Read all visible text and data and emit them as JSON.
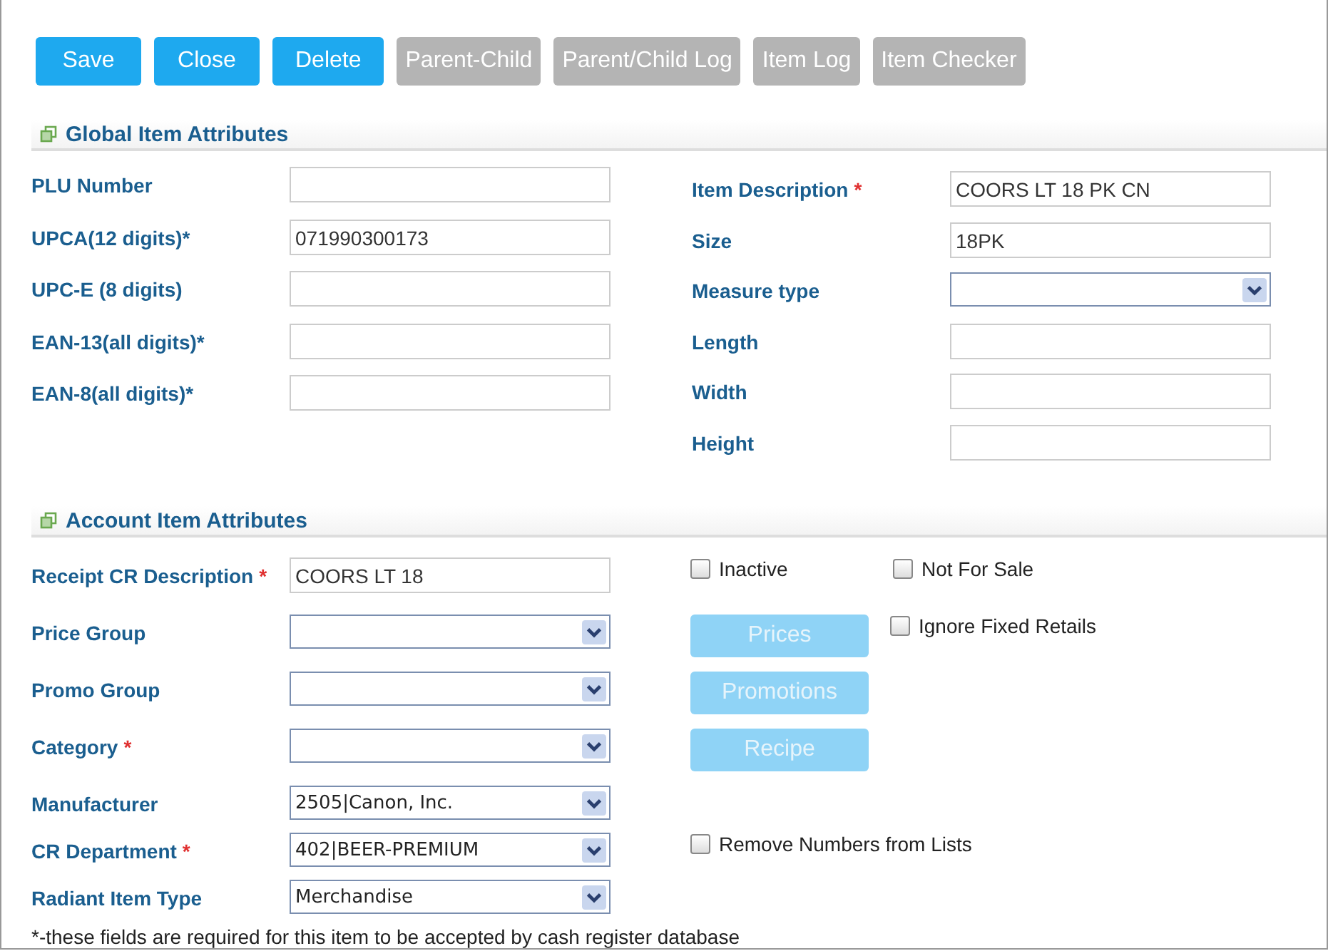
{
  "toolbar": [
    {
      "label": "Save",
      "disabled": false
    },
    {
      "label": "Close",
      "disabled": false
    },
    {
      "label": "Delete",
      "disabled": false
    },
    {
      "label": "Parent-Child",
      "disabled": true
    },
    {
      "label": "Parent/Child Log",
      "disabled": true
    },
    {
      "label": "Item Log",
      "disabled": true
    },
    {
      "label": "Item Checker",
      "disabled": true
    }
  ],
  "global_section": {
    "title": "Global Item Attributes",
    "left": [
      {
        "label": "PLU Number",
        "kind": "text"
      },
      {
        "label": "UPCA(12 digits)*",
        "kind": "text",
        "value": "071990300173"
      },
      {
        "label": "UPC-E (8 digits)",
        "kind": "text"
      },
      {
        "label": "EAN-13(all digits)*",
        "kind": "text"
      },
      {
        "label": "EAN-8(all digits)*",
        "kind": "text"
      }
    ],
    "right": [
      {
        "label": "Item Description",
        "required_mark": "*",
        "kind": "text",
        "value": "COORS LT 18 PK CN"
      },
      {
        "label": "Size",
        "kind": "text",
        "value": "18PK"
      },
      {
        "label": "Measure type",
        "kind": "select"
      },
      {
        "label": "Length",
        "kind": "text"
      },
      {
        "label": "Width",
        "kind": "text"
      },
      {
        "label": "Height",
        "kind": "text"
      }
    ]
  },
  "account_section": {
    "title": "Account Item Attributes",
    "rows": [
      {
        "label": "Receipt CR Description",
        "required_mark": "*",
        "kind": "text",
        "value": "COORS LT 18",
        "extras": [
          {
            "kind": "checkbox",
            "label": "Inactive",
            "checked": false
          },
          {
            "kind": "checkbox",
            "label": "Not For Sale",
            "checked": false
          }
        ]
      },
      {
        "label": "Price Group",
        "kind": "select",
        "extras": [
          {
            "kind": "button",
            "label": "Prices",
            "disabled": true
          },
          {
            "kind": "checkbox",
            "label": "Ignore Fixed Retails",
            "checked": false
          }
        ]
      },
      {
        "label": "Promo Group",
        "kind": "select",
        "extras": [
          {
            "kind": "button",
            "label": "Promotions",
            "disabled": true
          }
        ]
      },
      {
        "label": "Category",
        "required_mark": "*",
        "kind": "select",
        "extras": [
          {
            "kind": "button",
            "label": "Recipe",
            "disabled": true
          }
        ]
      },
      {
        "label": "Manufacturer",
        "kind": "select",
        "value": "2505|Canon, Inc."
      },
      {
        "label": "CR Department",
        "required_mark": "*",
        "kind": "select",
        "value": "402|BEER-PREMIUM",
        "extras": [
          {
            "kind": "checkbox",
            "label": "Remove Numbers from Lists",
            "checked": false
          }
        ]
      },
      {
        "label": "Radiant Item Type",
        "kind": "select",
        "value": "Merchandise"
      }
    ]
  },
  "footnote": "*-these fields are required for this item to be accepted by cash register database"
}
